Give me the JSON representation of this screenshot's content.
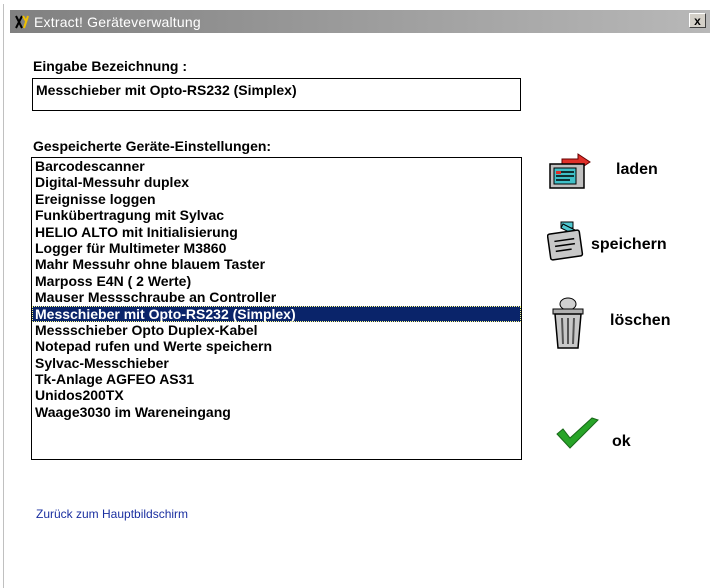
{
  "window": {
    "title": "Extract! Geräteverwaltung",
    "close_label": "x"
  },
  "input": {
    "label": "Eingabe Bezeichnung :",
    "value": "Messchieber mit Opto-RS232 (Simplex)"
  },
  "list": {
    "label": "Gespeicherte Geräte-Einstellungen:",
    "items": [
      "Barcodescanner",
      "Digital-Messuhr duplex",
      "Ereignisse loggen",
      "Funkübertragung mit Sylvac",
      "HELIO ALTO  mit Initialisierung",
      "Logger für Multimeter M3860",
      "Mahr Messuhr ohne blauem Taster",
      "Marposs E4N ( 2 Werte)",
      "Mauser Messschraube an Controller",
      "Messchieber mit Opto-RS232 (Simplex)",
      "Messschieber Opto Duplex-Kabel",
      "Notepad rufen und Werte speichern",
      "Sylvac-Messchieber",
      "Tk-Anlage AGFEO AS31",
      "Unidos200TX",
      "Waage3030 im Wareneingang"
    ],
    "selected_index": 9
  },
  "actions": {
    "load": "laden",
    "save": "speichern",
    "delete": "löschen",
    "ok": "ok"
  },
  "link": "Zurück zum Hauptbildschirm",
  "icons": {
    "load": "folder-load-icon",
    "save": "folder-save-icon",
    "delete": "trash-can-icon",
    "ok": "checkmark-icon"
  }
}
